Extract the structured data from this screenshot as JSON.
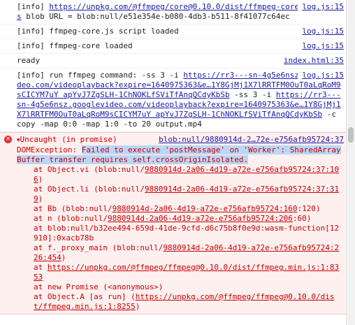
{
  "messages": [
    {
      "prefix": "[info] ",
      "link1": "https://unpkg.com/@ffmpeg/core@0.10.0/dist/ffmpeg-core.worker.js",
      "text": " blob URL = blob:null/e51e354e-b080-4db3-b511-8f41077c64ec",
      "source": "log.js:15"
    },
    {
      "prefix": "[info] ffmpeg-core.js script loaded",
      "source": "log.js:15"
    },
    {
      "prefix": "[info] ffmpeg-core loaded",
      "source": "log.js:15"
    },
    {
      "prefix": "ready",
      "source": "index.html:35"
    },
    {
      "prefix": "[info] run ffmpeg command: -ss 3 -i ",
      "link1": "https://rr3---sn-4g5e6nsz.googlevideo.com/videoplayback?expire=1640975363&e…1Y8GjMj1X7lRRTFM0OuT0aLqRoM9sCICYM7uY apYvJ7ZgSLH-1ChNOKLfSViTfAnqQCdyKbSb",
      "mid": " -ss 3 -i ",
      "link2": "https://rr3---sn-4g5e6nsz.googlevideo.com/videoplayback?expire=1640975363&e…1Y8GjMj1X7lRRTFM0OuT0aLqRoM9sCICYM7uY apYvJ7ZgSLH-1ChNOKLfSViTfAnqQCdyKbSb",
      "text": " -c copy -map 0:0 -map 1:0 -to 20 output.mp4",
      "source": "log.js:15"
    }
  ],
  "error": {
    "icon": "×",
    "caret": "▾",
    "title": "Uncaught (in promise)",
    "source": "blob:null/9880914d-2…72e-e756afb95724:37",
    "exc_prefix": "DOMException: ",
    "exc_hl": "Failed to execute 'postMessage' on 'Worker': SharedArrayBuffer transfer requires self.crossOriginIsolated.",
    "stack": [
      {
        "pre": "at Object.vi (blob:null/",
        "link": "9880914d-2a06-4d19-a72e-e756afb95724:37:106",
        "post": ")"
      },
      {
        "pre": "at Object.li (blob:null/",
        "link": "9880914d-2a06-4d19-a72e-e756afb95724:37:319",
        "post": ")"
      },
      {
        "pre": "at Bb (blob:null/",
        "link": "9880914d-2a06-4d19-a72e-e756afb95724:160",
        "post": ":120)"
      },
      {
        "pre": "at n (blob:null/",
        "link": "9880914d-2a06-4d19-a72e-e756afb95724:206",
        "post": ":60)"
      },
      {
        "pre": "at blob:null/b32ee494-659d-41de-9cfd-d6c75b8f0e9d:wasm-function[12910]:0xacb78b",
        "link": "",
        "post": ""
      },
      {
        "pre": "at f._proxy_main (blob:null/",
        "link": "9880914d-2a06-4d19-a72e-e756afb95724:226:454",
        "post": ")"
      },
      {
        "pre": "at ",
        "link": "https://unpkg.com/@ffmpeg/ffmpeg@0.10.0/dist/ffmpeg.min.js:1:8353",
        "post": ""
      },
      {
        "pre": "at new Promise (<anonymous>)",
        "link": "",
        "post": ""
      },
      {
        "pre": "at Object.A [as run] (",
        "link": "https://unpkg.com/@ffmpeg/ffmpeg@0.10.0/dist/ffmpeg.min.js:1:8255",
        "post": ")"
      }
    ]
  }
}
